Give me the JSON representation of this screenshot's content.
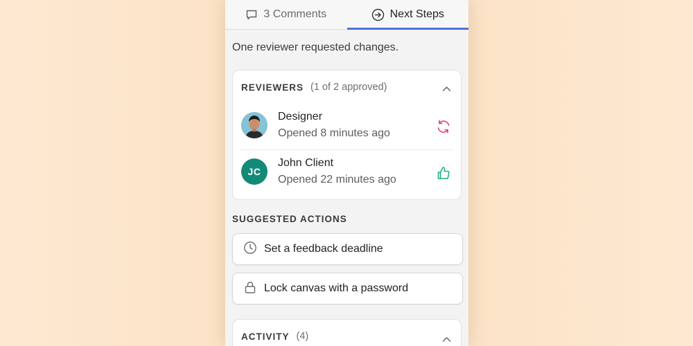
{
  "tabs": [
    {
      "label": "3 Comments",
      "icon": "comment-icon",
      "active": false
    },
    {
      "label": "Next Steps",
      "icon": "arrow-right-circle-icon",
      "active": true
    }
  ],
  "summary": "One reviewer requested changes.",
  "reviewers": {
    "title": "REVIEWERS",
    "count": "(1 of 2 approved)",
    "items": [
      {
        "name": "Designer",
        "time": "Opened 8 minutes ago",
        "status_icon": "sync-icon",
        "status_color": "#e0456a"
      },
      {
        "name": "John Client",
        "initials": "JC",
        "time": "Opened 22 minutes ago",
        "status_icon": "thumbs-up-icon",
        "status_color": "#1fae7e"
      }
    ]
  },
  "suggested_actions": {
    "title": "SUGGESTED ACTIONS",
    "items": [
      {
        "label": "Set a feedback deadline",
        "icon": "clock-icon"
      },
      {
        "label": "Lock canvas with a password",
        "icon": "lock-icon"
      }
    ]
  },
  "activity": {
    "title": "ACTIVITY",
    "count": "(4)"
  },
  "colors": {
    "accent": "#4c72d8",
    "avatar_jc": "#138a77",
    "background": "#fde5c9"
  }
}
